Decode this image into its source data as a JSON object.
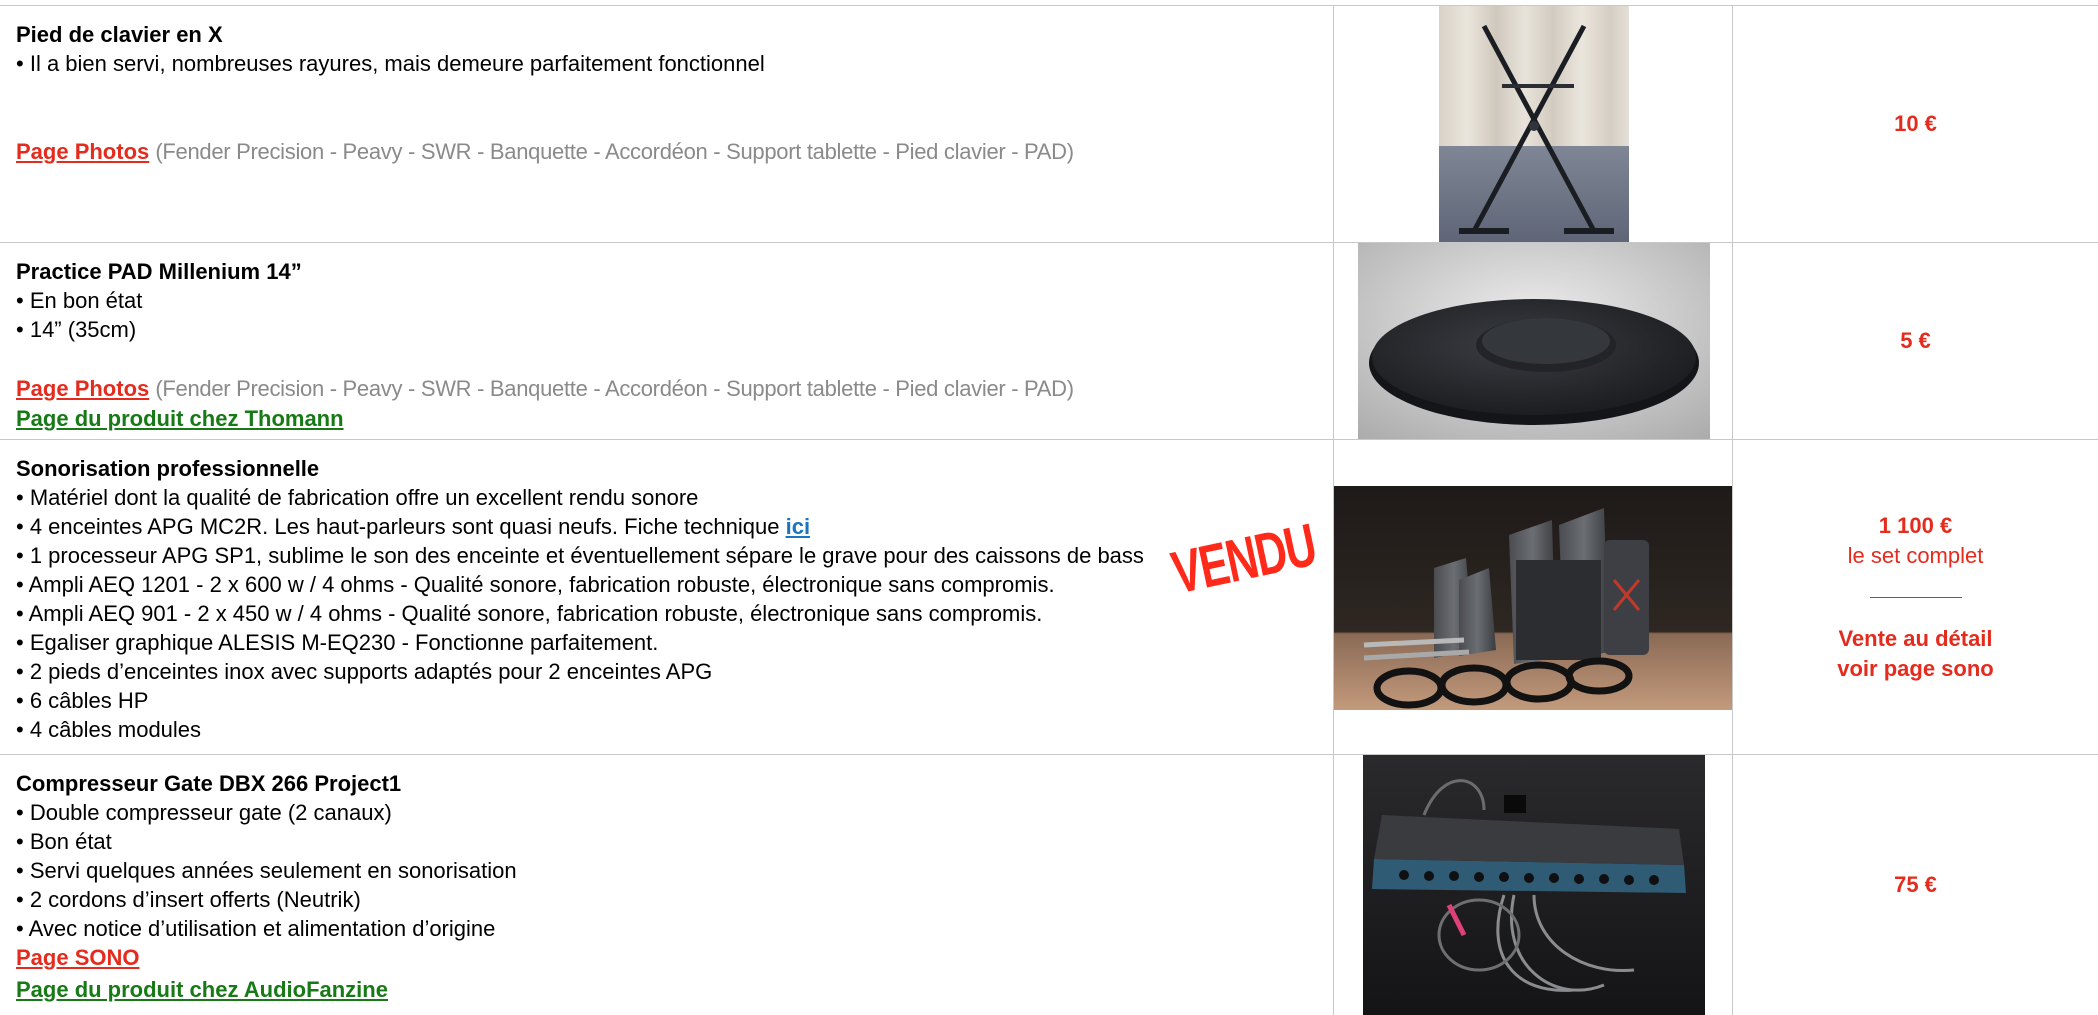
{
  "common": {
    "photos_link": "Page Photos",
    "photos_list": "(Fender Precision - Peavy - SWR - Banquette - Accordéon - Support tablette - Pied clavier - PAD)"
  },
  "items": [
    {
      "title": "Pied de clavier en X",
      "bullets": [
        "Il a bien servi, nombreuses rayures, mais demeure parfaitement fonctionnel"
      ],
      "price": "10 €"
    },
    {
      "title": "Practice PAD Millenium 14”",
      "bullets": [
        "En bon état",
        "14” (35cm)"
      ],
      "green_link": "Page du produit chez Thomann",
      "price": "5 €"
    },
    {
      "title": "Sonorisation professionnelle",
      "bullets": [
        "Matériel dont la qualité de fabrication offre un excellent rendu sonore",
        "4 enceintes APG MC2R. Les haut-parleurs sont quasi neufs. Fiche technique ",
        "1 processeur APG SP1, sublime le son des enceinte et éventuellement sépare le grave pour des caissons de bass",
        "Ampli AEQ 1201 - 2 x 600 w / 4 ohms - Qualité sonore, fabrication robuste, électronique sans compromis.",
        "Ampli AEQ 901 - 2 x 450 w / 4 ohms - Qualité sonore, fabrication robuste, électronique sans compromis.",
        "Egaliser graphique ALESIS M-EQ230 - Fonctionne parfaitement.",
        "2 pieds d’enceintes inox avec supports adaptés pour 2 enceintes APG",
        "6 câbles HP",
        "4 câbles modules"
      ],
      "inline_link": "ici",
      "stamp": "VENDU",
      "price": "1 100 €",
      "price_sub": "le set complet",
      "detail_line1": "Vente au détail",
      "detail_line2": "voir page sono"
    },
    {
      "title": "Compresseur Gate DBX 266 Project1",
      "bullets": [
        "Double compresseur gate (2 canaux)",
        "Bon état",
        "Servi quelques années seulement en sonorisation",
        "2 cordons d’insert offerts (Neutrik)",
        "Avec notice d’utilisation et alimentation d’origine"
      ],
      "red_link": "Page SONO",
      "green_link": "Page du produit chez AudioFanzine",
      "price": "75 €"
    }
  ],
  "colors": {
    "price_red": "#e52b1d",
    "link_green": "#177a17",
    "link_blue": "#1a74c4",
    "muted_gray": "#8a8a8a",
    "border": "#c8c8c8"
  }
}
